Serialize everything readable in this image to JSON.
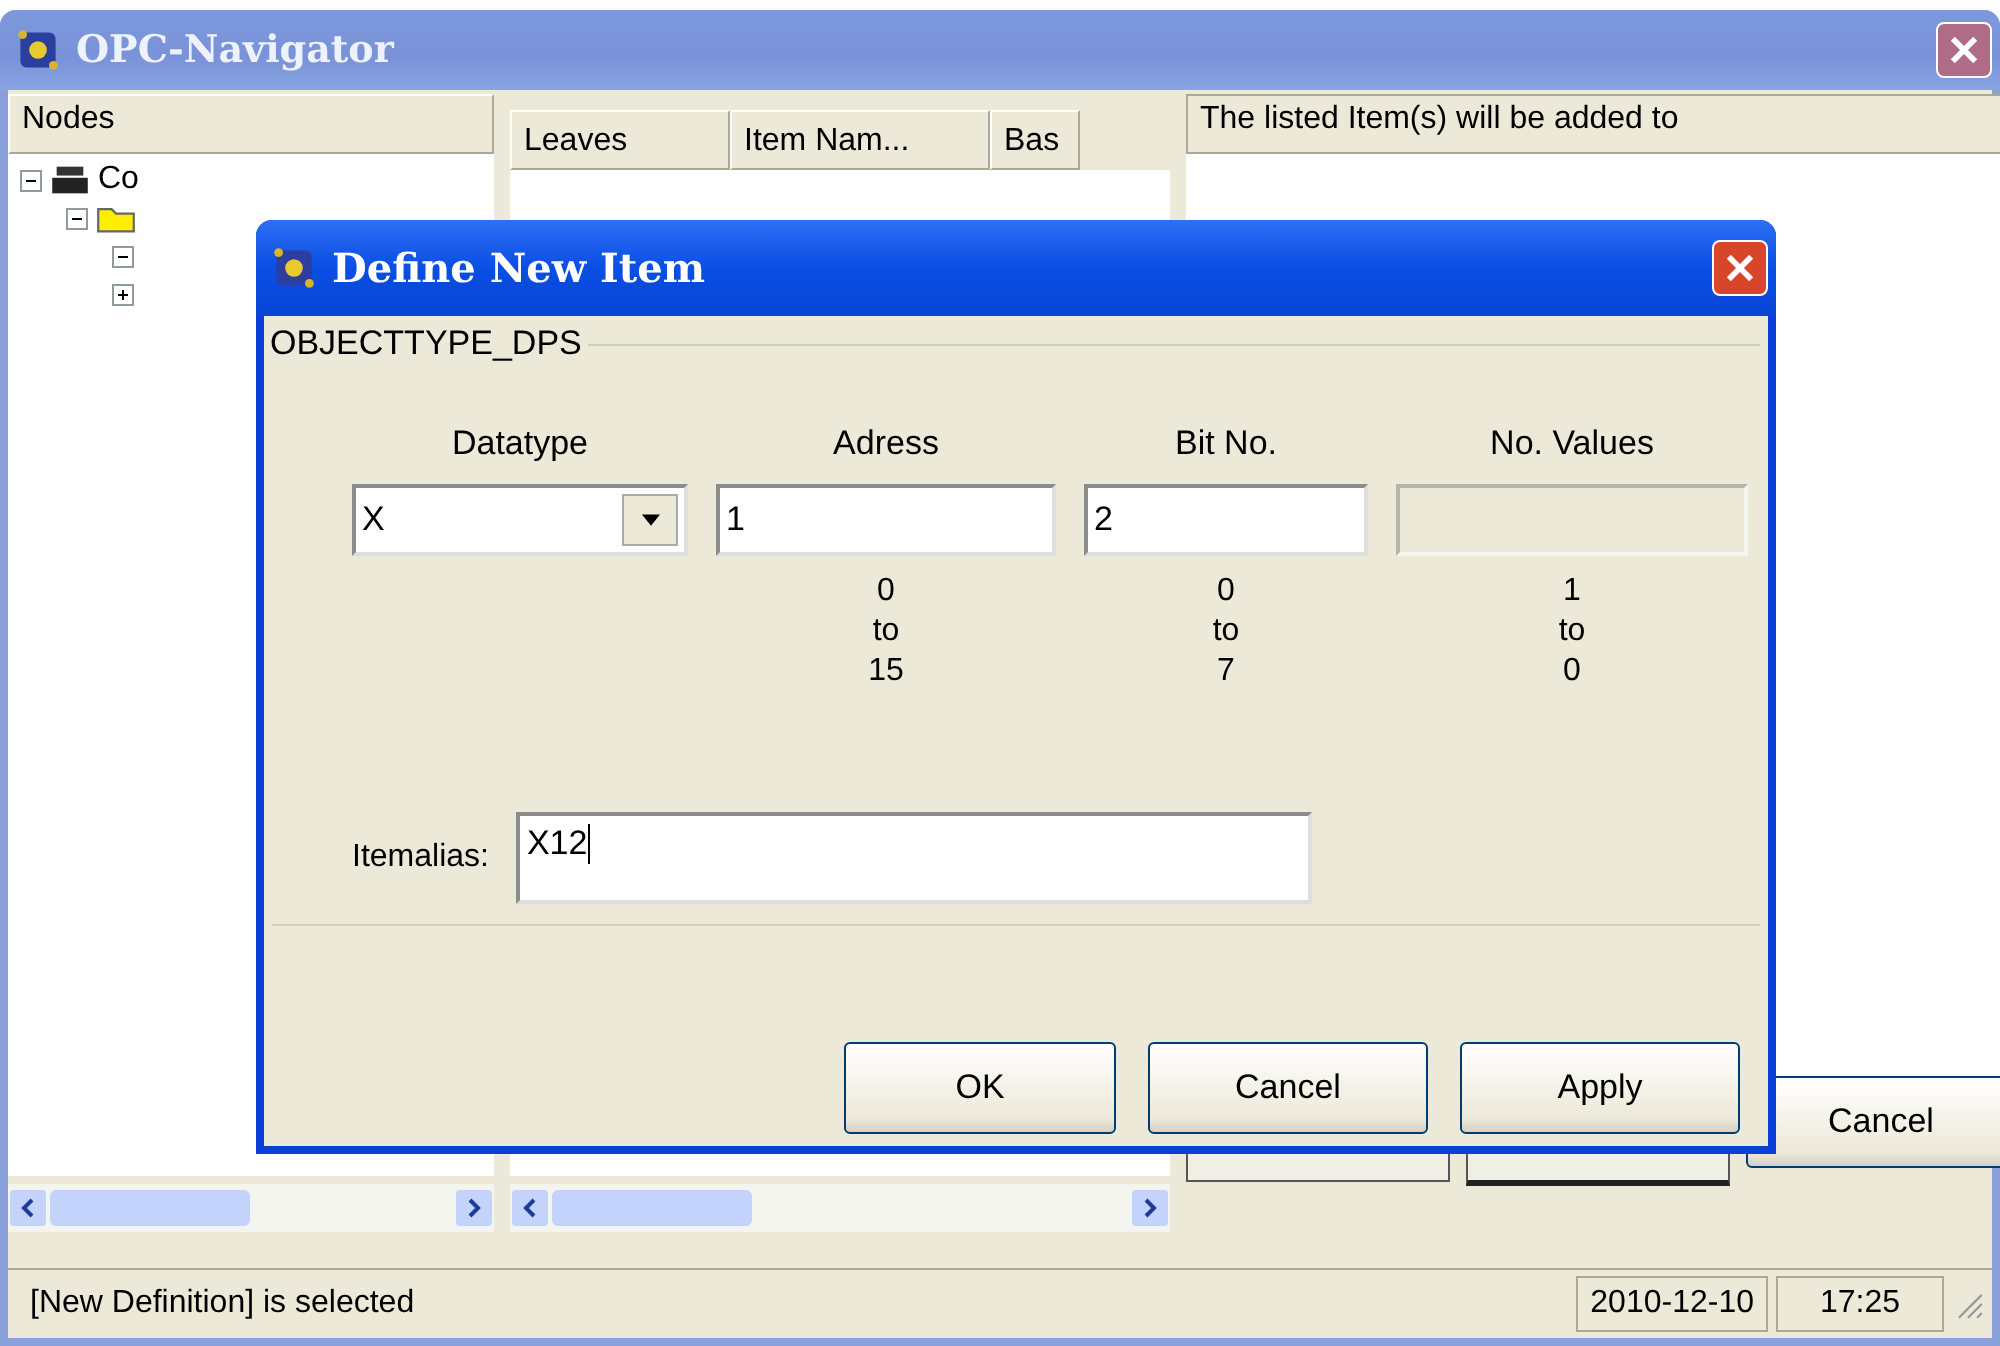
{
  "window": {
    "title": "OPC-Navigator"
  },
  "nodes_panel": {
    "header": "Nodes",
    "tree": [
      {
        "label": "Co",
        "kind": "server",
        "expanded": true,
        "children": [
          {
            "kind": "folder",
            "expanded": true,
            "children": [
              {
                "expanded": true
              },
              {
                "expanded": false
              }
            ]
          }
        ]
      }
    ]
  },
  "leaves_table": {
    "columns": [
      "Leaves",
      "Item Nam...",
      "Bas"
    ]
  },
  "target_panel": {
    "header": "The listed Item(s) will be added to",
    "buttons": [
      "Cancel"
    ]
  },
  "status_bar": {
    "message": "[New Definition] is selected",
    "date": "2010-12-10",
    "time": "17:25"
  },
  "dialog": {
    "title": "Define New Item",
    "group": "OBJECTTYPE_DPS",
    "fields": [
      {
        "label": "Datatype",
        "kind": "dropdown",
        "value": "X"
      },
      {
        "label": "Adress",
        "kind": "text",
        "value": "1",
        "disabled": false,
        "range": [
          "0",
          "to",
          "15"
        ]
      },
      {
        "label": "Bit No.",
        "kind": "text",
        "value": "2",
        "disabled": false,
        "range": [
          "0",
          "to",
          "7"
        ]
      },
      {
        "label": "No. Values",
        "kind": "text",
        "disabled": true,
        "range": [
          "1",
          "to",
          "0"
        ]
      }
    ],
    "alias": {
      "label": "Itemalias:",
      "value": "X12"
    },
    "buttons": [
      "OK",
      "Cancel",
      "Apply"
    ]
  }
}
